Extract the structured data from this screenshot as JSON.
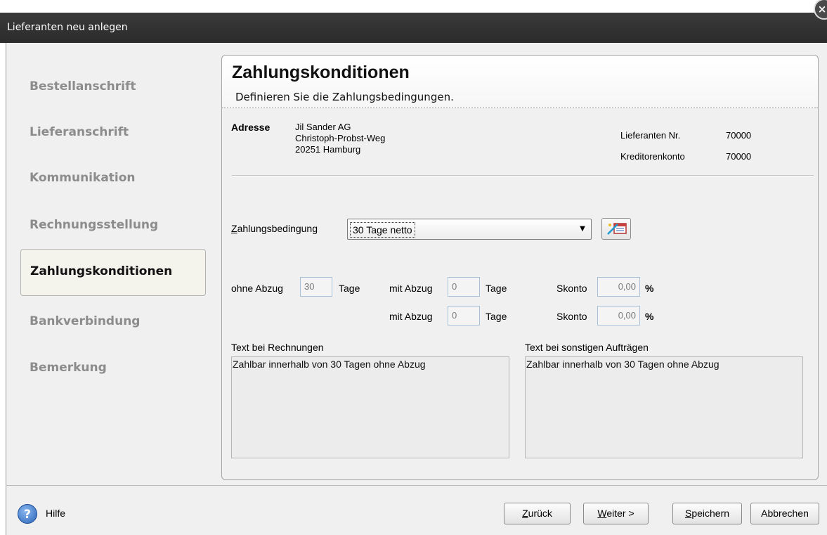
{
  "window": {
    "title": "Lieferanten neu anlegen"
  },
  "nav": {
    "items": [
      {
        "label": "Bestellanschrift",
        "active": false
      },
      {
        "label": "Lieferanschrift",
        "active": false
      },
      {
        "label": "Kommunikation",
        "active": false
      },
      {
        "label": "Rechnungsstellung",
        "active": false
      },
      {
        "label": "Zahlungskonditionen",
        "active": true
      },
      {
        "label": "Bankverbindung",
        "active": false
      },
      {
        "label": "Bemerkung",
        "active": false
      }
    ]
  },
  "panel": {
    "title": "Zahlungskonditionen",
    "subtitle": "Definieren Sie die Zahlungsbedingungen."
  },
  "address": {
    "label": "Adresse",
    "line1": "Jil Sander AG",
    "line2": "Christoph-Probst-Weg",
    "line3": "20251 Hamburg",
    "supplier_no_label": "Lieferanten Nr.",
    "supplier_no": "70000",
    "creditor_label": "Kreditorenkonto",
    "creditor": "70000"
  },
  "payment": {
    "condition_label_underlined": "Z",
    "condition_label_rest": "ahlungsbedingung",
    "condition_value": "30 Tage netto",
    "ohne_abzug_label": "ohne Abzug",
    "ohne_abzug_days": "30",
    "mit_abzug_label": "mit Abzug",
    "mit_abzug_days_1": "0",
    "mit_abzug_days_2": "0",
    "tage_label": "Tage",
    "skonto_label": "Skonto",
    "skonto_1": "0,00",
    "skonto_2": "0,00",
    "percent": "%"
  },
  "texts": {
    "invoice_label": "Text bei Rechnungen",
    "invoice_text": "Zahlbar innerhalb von 30 Tagen ohne Abzug",
    "other_label": "Text bei sonstigen Aufträgen",
    "other_text": "Zahlbar innerhalb von 30 Tagen ohne Abzug"
  },
  "footer": {
    "help_label": "Hilfe",
    "back_u": "Z",
    "back_rest": "urück",
    "next_u": "W",
    "next_rest": "eiter >",
    "save_u": "S",
    "save_rest": "peichern",
    "cancel": "Abbrechen"
  },
  "colors": {
    "titlebar": "#2e2e2e",
    "background": "#f0f0f0",
    "field_border": "#a9c1d8"
  }
}
